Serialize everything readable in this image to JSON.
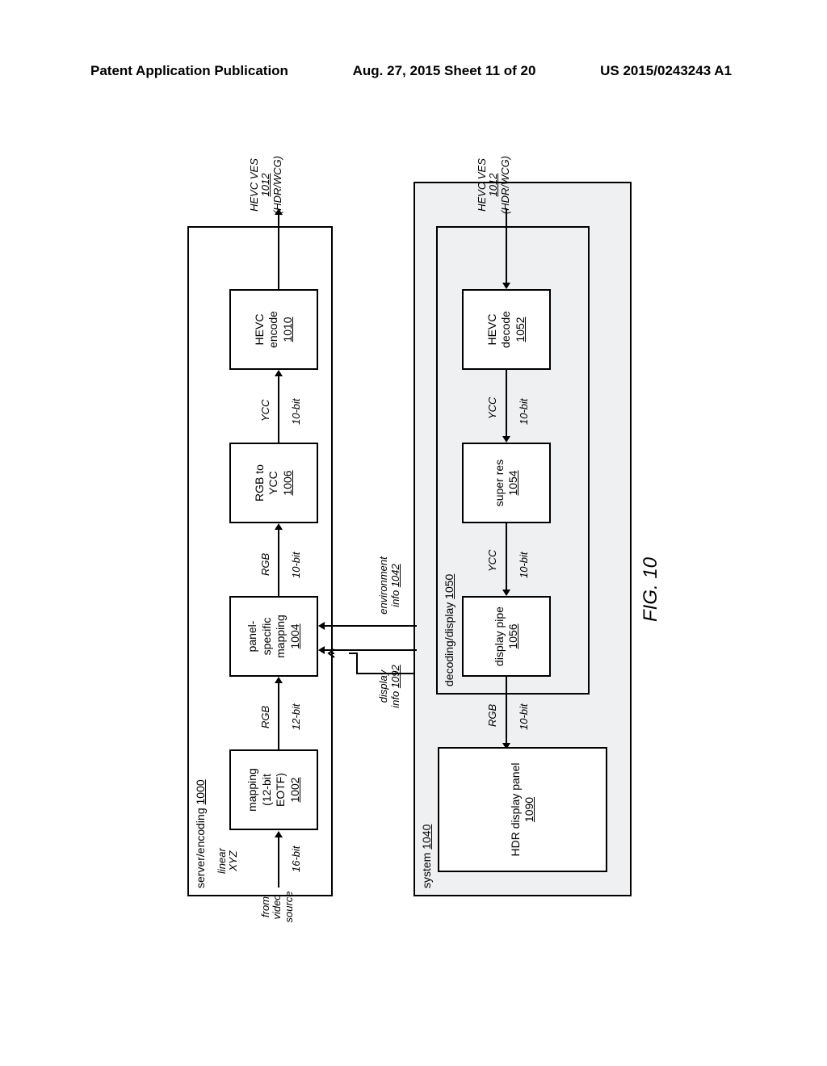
{
  "header": {
    "left": "Patent Application Publication",
    "center": "Aug. 27, 2015  Sheet 11 of 20",
    "right": "US 2015/0243243 A1"
  },
  "encoder": {
    "title": "server/encoding ",
    "title_ref": "1000",
    "src": "from\nvideo\nsource",
    "in_top": "linear\nXYZ",
    "in_bot": "16-bit",
    "b1": {
      "l1": "mapping",
      "l2": "(12-bit",
      "l3": "EOTF)",
      "ref": "1002"
    },
    "a12_top": "RGB",
    "a12_bot": "12-bit",
    "b2": {
      "l1": "panel-",
      "l2": "specific",
      "l3": "mapping",
      "ref": "1004"
    },
    "a23_top": "RGB",
    "a23_bot": "10-bit",
    "b3": {
      "l1": "RGB to",
      "l2": "YCC",
      "ref": "1006"
    },
    "a34_top": "YCC",
    "a34_bot": "10-bit",
    "b4": {
      "l1": "HEVC",
      "l2": "encode",
      "ref": "1010"
    },
    "out_top": "HEVC VES",
    "out_ref": "1012",
    "out_bot": "(HDR/WCG)"
  },
  "feedback": {
    "display_info": "display\ninfo ",
    "display_ref": "1092",
    "env_info": "environment\ninfo ",
    "env_ref": "1042"
  },
  "system": {
    "title": "system ",
    "title_ref": "1040"
  },
  "decode": {
    "title": "decoding/display ",
    "title_ref": "1050",
    "b1": {
      "l1": "HEVC",
      "l2": "decode",
      "ref": "1052"
    },
    "in_top": "HEVC VES",
    "in_ref": "1012",
    "in_bot": "(HDR/WCG)",
    "a12_top": "YCC",
    "a12_bot": "10-bit",
    "b2": {
      "l1": "super res",
      "ref": "1054"
    },
    "a23_top": "YCC",
    "a23_bot": "10-bit",
    "b3": {
      "l1": "display pipe",
      "ref": "1056"
    },
    "a34_top": "RGB",
    "a34_bot": "10-bit"
  },
  "panel": {
    "l1": "HDR display panel",
    "ref": "1090"
  },
  "fig": "FIG. 10"
}
